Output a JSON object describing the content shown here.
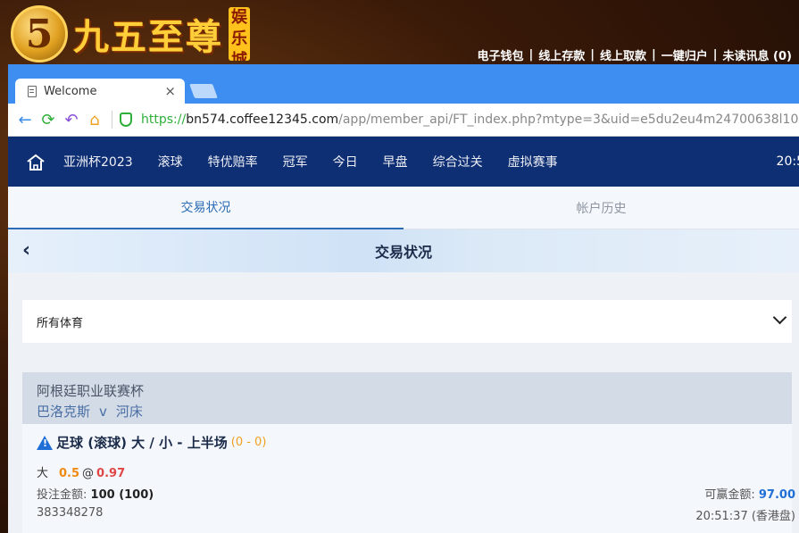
{
  "banner": {
    "logo_digit": "5",
    "logo_text": "九五至尊",
    "logo_tag": "娱乐城",
    "links": [
      "电子钱包",
      "线上存款",
      "线上取款",
      "一键归户",
      "未读讯息 (0)"
    ]
  },
  "browser": {
    "tab_title": "Welcome",
    "tab_close": "×",
    "url_protocol": "https://",
    "url_host": "bn574.coffee12345.com",
    "url_path": "/app/member_api/FT_index.php?mtype=3&uid=e5du2eu4m24700638l10"
  },
  "nav": {
    "items": [
      "亚洲杯2023",
      "滚球",
      "特优赔率",
      "冠军",
      "今日",
      "早盘",
      "综合过关",
      "虚拟赛事"
    ],
    "time": "20:5"
  },
  "subtabs": {
    "active": "交易状况",
    "inactive": "帐户历史"
  },
  "page": {
    "back": "‹",
    "title": "交易状况"
  },
  "filter": {
    "selected": "所有体育"
  },
  "bet": {
    "league": "阿根廷职业联赛杯",
    "home": "巴洛克斯",
    "vs": "v",
    "away": "河床",
    "title": "足球 (滚球) 大 / 小 - 上半场",
    "score": "(0 - 0)",
    "pick": "大",
    "handicap": "0.5",
    "at": "@",
    "odds": "0.97",
    "stake_label": "投注金额:",
    "stake_value": "100 (100)",
    "win_label": "可赢金额:",
    "win_value": "97.00",
    "ticket_id": "383348278",
    "time": "20:51:37 (香港盘)"
  },
  "colors": {
    "nav_bg": "#0f2f74",
    "tabbar_bg": "#3d8ef0",
    "active_tab": "#2b6cb5",
    "handicap": "#f08a10",
    "odds": "#e04848",
    "win_amount": "#1f6fd6"
  }
}
